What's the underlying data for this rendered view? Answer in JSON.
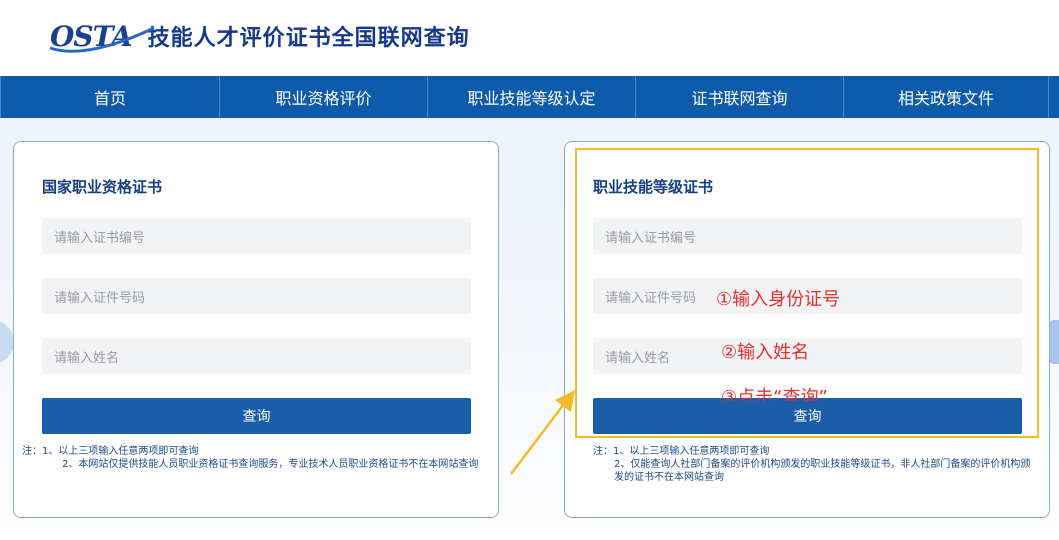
{
  "header": {
    "logo_text": "OSTA",
    "site_title": "技能人才评价证书全国联网查询"
  },
  "nav": {
    "items": [
      {
        "label": "首页"
      },
      {
        "label": "职业资格评价"
      },
      {
        "label": "职业技能等级认定"
      },
      {
        "label": "证书联网查询"
      },
      {
        "label": "相关政策文件"
      }
    ]
  },
  "left_card": {
    "title": "国家职业资格证书",
    "cert_no_placeholder": "请输入证书编号",
    "id_no_placeholder": "请输入证件号码",
    "name_placeholder": "请输入姓名",
    "button_label": "查询",
    "note_line1": "注：1、以上三项输入任意两项即可查询",
    "note_line2": "2、本网站仅提供技能人员职业资格证书查询服务，专业技术人员职业资格证书不在本网站查询"
  },
  "right_card": {
    "title": "职业技能等级证书",
    "cert_no_placeholder": "请输入证书编号",
    "id_no_placeholder": "请输入证件号码",
    "name_placeholder": "请输入姓名",
    "button_label": "查询",
    "note_line1": "注：1、以上三项输入任意两项即可查询",
    "note_line2": "2、仅能查询人社部门备案的评价机构颁发的职业技能等级证书，非人社部门备案的评价机构颁发的证书不在本网站查询"
  },
  "annotations": {
    "step1": "①输入身份证号",
    "step2": "②输入姓名",
    "step3": "③点击“查询”"
  },
  "colors": {
    "nav_bg": "#0d5baa",
    "button_bg": "#1a5ea9",
    "highlight_border": "#f5b92a",
    "annotation_red": "#e8302c",
    "arrow": "#f5b92a"
  }
}
